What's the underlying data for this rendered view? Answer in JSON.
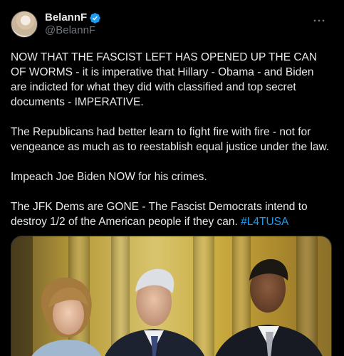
{
  "author": {
    "display_name": "BelannF",
    "handle": "@BelannF",
    "verified": true,
    "avatar_icon": "profile-photo"
  },
  "menu": {
    "more_label": "···"
  },
  "post": {
    "paragraphs": [
      "NOW THAT THE FASCIST LEFT HAS OPENED UP THE CAN OF WORMS - it is imperative that Hillary - Obama - and Biden are indicted for what they did with classified and top secret documents - IMPERATIVE.",
      "The Republicans had better learn to fight fire with fire - not for vengeance as much as to reestablish equal justice under the law.",
      "Impeach Joe Biden NOW for his crimes."
    ],
    "last_paragraph_text": "The JFK Dems are GONE - The Fascist Democrats intend to destroy 1/2 of the American people if they can. ",
    "hashtag": "#L4TUSA"
  },
  "colors": {
    "background": "#000000",
    "text": "#e7e9ea",
    "secondary": "#71767b",
    "accent": "#1d9bf0"
  }
}
